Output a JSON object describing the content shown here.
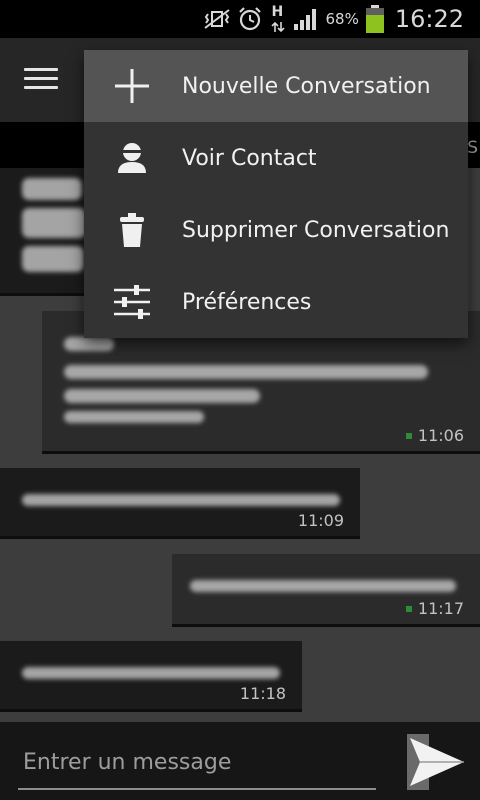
{
  "status_bar": {
    "network": "H",
    "battery": "68%",
    "time": "16:22",
    "battery_color": "#8dc21f"
  },
  "overflow_menu": {
    "items": [
      {
        "icon": "plus-icon",
        "label": "Nouvelle Conversation"
      },
      {
        "icon": "contact-icon",
        "label": "Voir Contact"
      },
      {
        "icon": "trash-icon",
        "label": "Supprimer Conversation"
      },
      {
        "icon": "sliders-icon",
        "label": "Préférences"
      }
    ]
  },
  "messages": [
    {
      "direction": "received",
      "time": ""
    },
    {
      "direction": "sent",
      "time": "11:06",
      "delivered": true
    },
    {
      "direction": "received",
      "time": "11:09"
    },
    {
      "direction": "sent",
      "time": "11:17",
      "delivered": true
    },
    {
      "direction": "received",
      "time": "11:18"
    }
  ],
  "compose": {
    "placeholder": "Entrer un message"
  },
  "colors": {
    "delivered_dot": "#2e8b3a"
  }
}
